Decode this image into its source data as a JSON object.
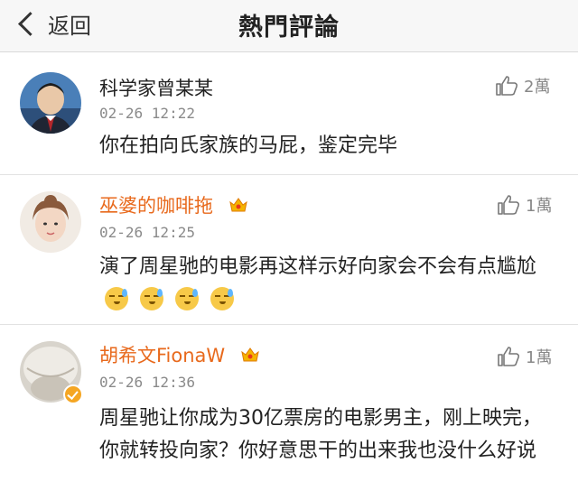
{
  "header": {
    "back_label": "返回",
    "title": "熱門評論"
  },
  "comments": [
    {
      "username": "科学家曾某某",
      "time": "02-26 12:22",
      "likes": "2萬",
      "text": "你在拍向氏家族的马屁，鉴定完毕"
    },
    {
      "username": "巫婆的咖啡拖",
      "time": "02-26 12:25",
      "likes": "1萬",
      "text": "演了周星驰的电影再这样示好向家会不会有点尴尬"
    },
    {
      "username": "胡希文FionaW",
      "time": "02-26 12:36",
      "likes": "1萬",
      "text": "周星驰让你成为30亿票房的电影男主，刚上映完，你就转投向家？你好意思干的出来我也没什么好说"
    }
  ],
  "colors": {
    "vip_name": "#e8691c",
    "meta": "#8a8a8a",
    "badge": "#f5a623"
  }
}
